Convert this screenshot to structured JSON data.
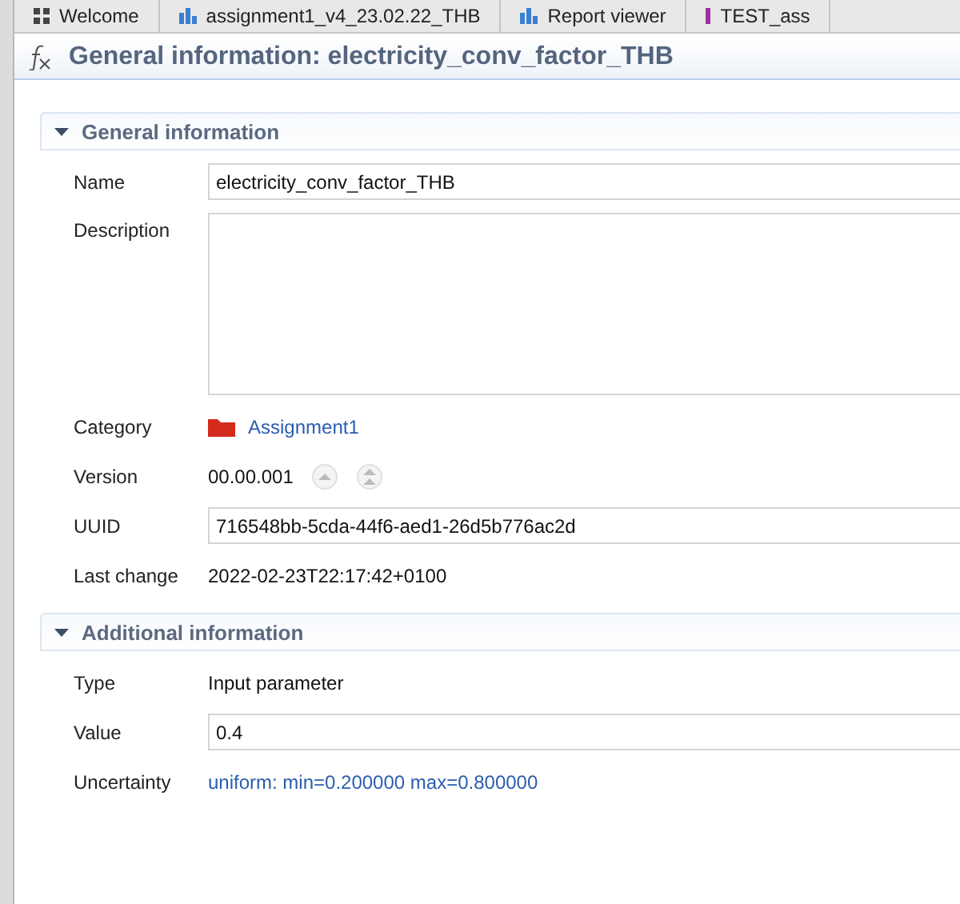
{
  "tabs": [
    {
      "label": "Welcome",
      "selected": false
    },
    {
      "label": "assignment1_v4_23.02.22_THB",
      "selected": false
    },
    {
      "label": "Report viewer",
      "selected": false
    },
    {
      "label": "TEST_ass",
      "selected": false
    }
  ],
  "title": {
    "text": "General information: electricity_conv_factor_THB"
  },
  "sections": [
    {
      "title": "General information",
      "expanded": true,
      "rows": [
        {
          "kind": "input",
          "label": "Name",
          "value": "electricity_conv_factor_THB"
        },
        {
          "kind": "textarea",
          "label": "Description"
        },
        {
          "kind": "category",
          "label": "Category",
          "value": "Assignment1"
        },
        {
          "kind": "version",
          "label": "Version",
          "value": "00.00.001"
        },
        {
          "kind": "input",
          "label": "UUID",
          "value": "716548bb-5cda-44f6-aed1-26d5b776ac2d"
        },
        {
          "kind": "text",
          "label": "Last change",
          "value": "2022-02-23T22:17:42+0100"
        }
      ]
    },
    {
      "title": "Additional information",
      "expanded": true,
      "rows": [
        {
          "kind": "text",
          "label": "Type",
          "value": "Input parameter"
        },
        {
          "kind": "input",
          "label": "Value",
          "value": "0.4"
        },
        {
          "kind": "link",
          "label": "Uncertainty",
          "value": "uniform: min=0.200000 max=0.800000"
        }
      ]
    }
  ]
}
